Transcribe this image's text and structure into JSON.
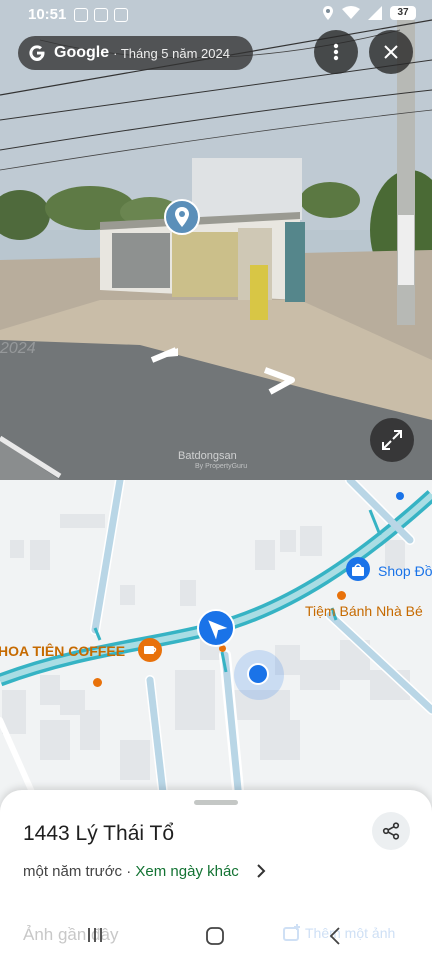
{
  "status_bar": {
    "time": "10:51",
    "battery": "37"
  },
  "street_view": {
    "provider": "Google",
    "capture_date": "· Tháng 5 năm 2024",
    "watermark": "Batdongsan",
    "watermark_sub": "By PropertyGuru",
    "watermark_year": "2024"
  },
  "map": {
    "pois": [
      {
        "name": "HOA TIÊN COFFEE",
        "color": "#c66a00"
      },
      {
        "name": "Shop Đồ",
        "color": "#1a73e8"
      },
      {
        "name": "Tiệm Bánh Nhà Bé",
        "color": "#c66a00"
      }
    ]
  },
  "sheet": {
    "address": "1443 Lý Thái Tổ",
    "time_ago": "một năm trước",
    "separator": "·",
    "other_dates_link": "Xem ngày khác",
    "recent_photos": "Ảnh gần đây",
    "add_photo": "Thêm một ảnh"
  },
  "colors": {
    "road_teal": "#36b3c4",
    "nav_blue": "#1a73e8",
    "poi_orange": "#e8710a"
  }
}
